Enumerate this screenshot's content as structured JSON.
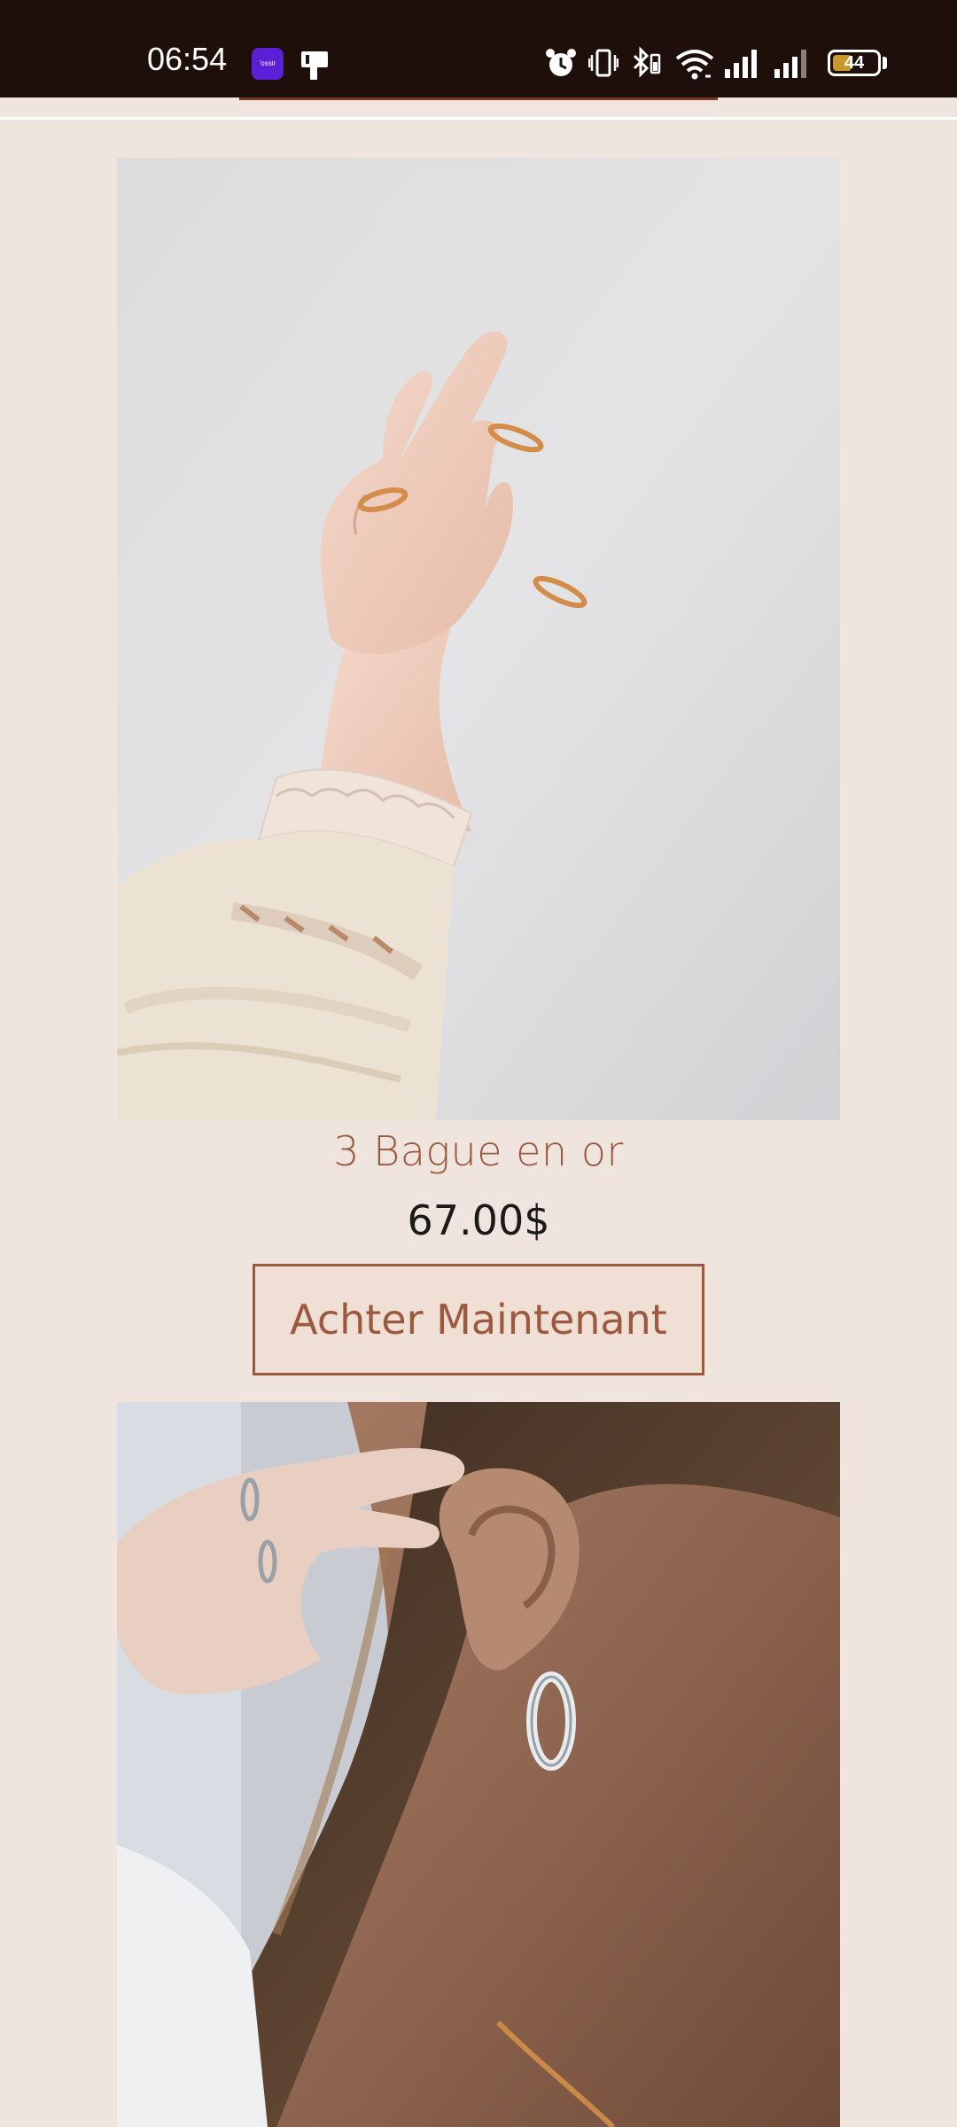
{
  "status_bar": {
    "time": "06:54",
    "app_icon_label": "'ossir",
    "battery_level": "44",
    "icons": [
      "alarm-icon",
      "vibrate-icon",
      "bluetooth-icon",
      "wifi-icon",
      "signal-icon",
      "signal-icon-2",
      "battery-icon"
    ],
    "background": "#1f0f0a"
  },
  "products": [
    {
      "image_icon": "hand-with-gold-rings-photo",
      "title": "3 Bague en or",
      "price": "67.00$",
      "button_label": "Achter Maintenant"
    },
    {
      "image_icon": "ear-with-silver-hoop-earring-photo"
    }
  ],
  "colors": {
    "page_background": "#f0e5de",
    "accent": "#9b5a3f",
    "button_background": "#f0dfd4",
    "price_text": "#1a1a1a"
  }
}
